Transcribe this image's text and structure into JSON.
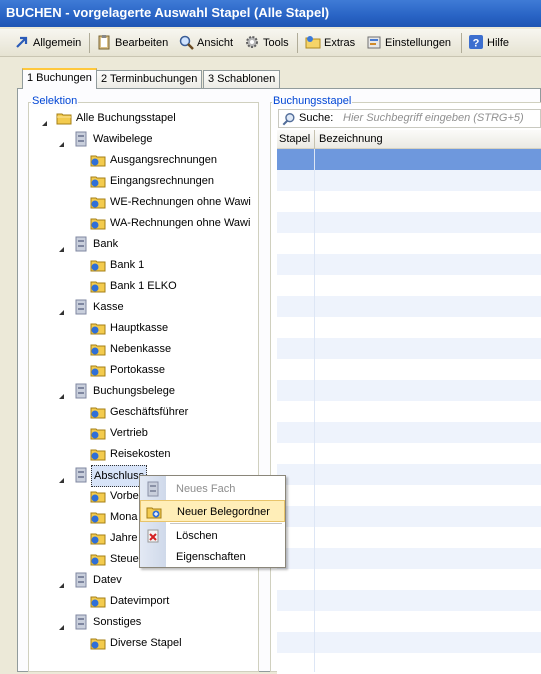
{
  "window": {
    "title": "BUCHEN - vorgelagerte Auswahl Stapel (Alle Stapel)"
  },
  "menu": [
    {
      "label": "Allgemein",
      "icon": "arrow-icon"
    },
    {
      "label": "Bearbeiten",
      "icon": "clipboard-icon"
    },
    {
      "label": "Ansicht",
      "icon": "magnifier-icon"
    },
    {
      "label": "Tools",
      "icon": "gear-icon"
    },
    {
      "label": "Extras",
      "icon": "folder-star-icon"
    },
    {
      "label": "Einstellungen",
      "icon": "settings-icon"
    },
    {
      "label": "Hilfe",
      "icon": "help-icon"
    }
  ],
  "tabs": [
    {
      "label": "1 Buchungen",
      "active": true
    },
    {
      "label": "2 Terminbuchungen",
      "active": false
    },
    {
      "label": "3 Schablonen",
      "active": false
    }
  ],
  "selection": {
    "title": "Selektion",
    "root": "Alle Buchungsstapel",
    "groups": [
      {
        "label": "Wawibelege",
        "items": [
          "Ausgangsrechnungen",
          "Eingangsrechnungen",
          "WE-Rechnungen ohne Wawi",
          "WA-Rechnungen ohne Wawi"
        ]
      },
      {
        "label": "Bank",
        "items": [
          "Bank 1",
          "Bank 1 ELKO"
        ]
      },
      {
        "label": "Kasse",
        "items": [
          "Hauptkasse",
          "Nebenkasse",
          "Portokasse"
        ]
      },
      {
        "label": "Buchungsbelege",
        "items": [
          "Geschäftsführer",
          "Vertrieb",
          "Reisekosten"
        ]
      },
      {
        "label": "Abschluss",
        "items": [
          "Vorbe",
          "Mona",
          "Jahre",
          "Steue"
        ]
      },
      {
        "label": "Datev",
        "items": [
          "Datevimport"
        ]
      },
      {
        "label": "Sonstiges",
        "items": [
          "Diverse Stapel"
        ]
      }
    ]
  },
  "stapel": {
    "title": "Buchungsstapel",
    "search_label": "Suche:",
    "search_placeholder": "Hier Suchbegriff eingeben (STRG+5)",
    "columns": [
      "Stapel",
      "Bezeichnung"
    ]
  },
  "context_menu": [
    {
      "label": "Neues Fach",
      "enabled": false
    },
    {
      "label": "Neuer Belegordner",
      "enabled": true,
      "highlighted": true
    },
    {
      "label": "Löschen",
      "enabled": true
    },
    {
      "label": "Eigenschaften",
      "enabled": true
    }
  ],
  "colors": {
    "title_bar": "#2863c4",
    "selected_row": "#6e98dd",
    "alt_row": "#eef3fc",
    "menu_highlight": "#ffeeb8"
  }
}
